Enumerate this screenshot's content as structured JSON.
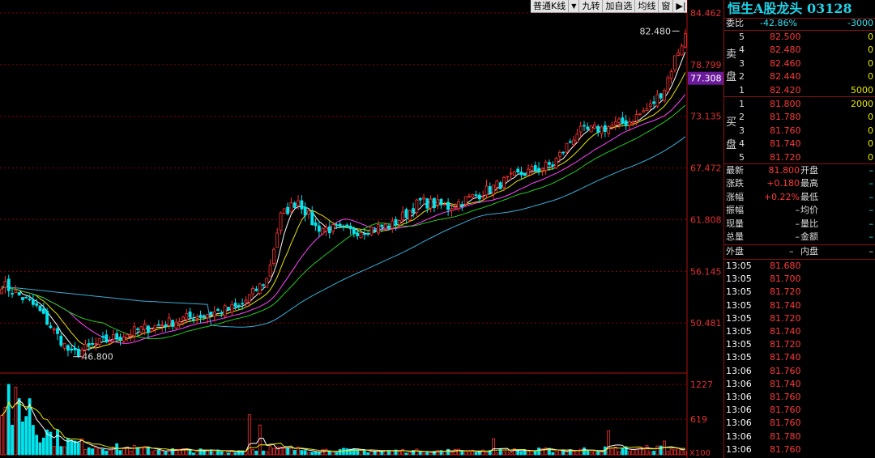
{
  "toolbar": {
    "items": [
      "普通K线",
      "九转",
      "加自选",
      "均线",
      "窗"
    ],
    "dropdown_icon": "dropdown-arrow-icon",
    "end_icon": "arrow-right-icon"
  },
  "quote": {
    "title": "恒生A股龙头 03128",
    "weibi": {
      "label": "委比",
      "value": "-42.86%",
      "diff": "-3000"
    },
    "sell_label": [
      "卖",
      "盘"
    ],
    "buy_label": [
      "买",
      "盘"
    ],
    "asks": [
      {
        "level": "5",
        "price": "82.500",
        "volume": "0"
      },
      {
        "level": "4",
        "price": "82.480",
        "volume": "0"
      },
      {
        "level": "3",
        "price": "82.460",
        "volume": "0"
      },
      {
        "level": "2",
        "price": "82.440",
        "volume": "0"
      },
      {
        "level": "1",
        "price": "82.420",
        "volume": "5000"
      }
    ],
    "bids": [
      {
        "level": "1",
        "price": "81.800",
        "volume": "2000"
      },
      {
        "level": "2",
        "price": "81.780",
        "volume": "0"
      },
      {
        "level": "3",
        "price": "81.760",
        "volume": "0"
      },
      {
        "level": "4",
        "price": "81.740",
        "volume": "0"
      },
      {
        "level": "5",
        "price": "81.720",
        "volume": "0"
      }
    ],
    "stats": [
      {
        "l1": "最新",
        "v1": "81.800",
        "l2": "开盘",
        "v2": ""
      },
      {
        "l1": "涨跌",
        "v1": "+0.180",
        "l2": "最高",
        "v2": ""
      },
      {
        "l1": "涨幅",
        "v1": "+0.22%",
        "l2": "最低",
        "v2": ""
      },
      {
        "l1": "振幅",
        "v1": "",
        "l2": "均价",
        "v2": ""
      },
      {
        "l1": "现量",
        "v1": "",
        "l2": "量比",
        "v2": ""
      },
      {
        "l1": "总量",
        "v1": "",
        "l2": "金额",
        "v2": ""
      }
    ],
    "dash": "–",
    "outer_label": "外盘",
    "inner_label": "内盘",
    "ticks": [
      {
        "time": "13:05",
        "price": "81.680"
      },
      {
        "time": "13:05",
        "price": "81.700"
      },
      {
        "time": "13:05",
        "price": "81.720"
      },
      {
        "time": "13:05",
        "price": "81.740"
      },
      {
        "time": "13:05",
        "price": "81.720"
      },
      {
        "time": "13:05",
        "price": "81.740"
      },
      {
        "time": "13:05",
        "price": "81.720"
      },
      {
        "time": "13:05",
        "price": "81.740"
      },
      {
        "time": "13:06",
        "price": "81.760"
      },
      {
        "time": "13:06",
        "price": "81.740"
      },
      {
        "time": "13:06",
        "price": "81.760"
      },
      {
        "time": "13:06",
        "price": "81.760"
      },
      {
        "time": "13:06",
        "price": "81.760"
      },
      {
        "time": "13:06",
        "price": "81.780"
      },
      {
        "time": "13:06",
        "price": "81.760"
      }
    ]
  },
  "chart_data": {
    "type": "candlestick",
    "price_axis_ticks": [
      "84.462",
      "78.799",
      "73.135",
      "67.472",
      "61.808",
      "56.145",
      "50.481"
    ],
    "current_price_label": "77.308",
    "high_label": "82.480",
    "low_label": "46.800",
    "volume_axis_ticks": [
      "1227",
      "619"
    ],
    "volume_unit": "X100",
    "colors": {
      "up": "#ff3232",
      "down": "#00e5ee",
      "ma1": "#ffffff",
      "ma2": "#e6e600",
      "ma3": "#ff44ff",
      "ma4": "#22cc22",
      "ma5": "#3aaed8",
      "grid": "#8b0000"
    },
    "price_keypoints": [
      [
        0,
        54.8
      ],
      [
        10,
        52.2
      ],
      [
        20,
        47.0
      ],
      [
        28,
        48.3
      ],
      [
        40,
        49.8
      ],
      [
        55,
        51.2
      ],
      [
        68,
        52.2
      ],
      [
        76,
        55.3
      ],
      [
        80,
        62.2
      ],
      [
        85,
        64.0
      ],
      [
        90,
        61.0
      ],
      [
        100,
        60.5
      ],
      [
        112,
        61.2
      ],
      [
        120,
        63.8
      ],
      [
        128,
        63.2
      ],
      [
        138,
        64.8
      ],
      [
        148,
        66.7
      ],
      [
        158,
        67.9
      ],
      [
        165,
        71.4
      ],
      [
        172,
        71.8
      ],
      [
        180,
        72.6
      ],
      [
        186,
        74.2
      ],
      [
        190,
        76.2
      ],
      [
        193,
        79.5
      ],
      [
        196,
        82.0
      ]
    ],
    "volume_keypoints": [
      [
        0,
        560
      ],
      [
        3,
        1050
      ],
      [
        5,
        1000
      ],
      [
        7,
        900
      ],
      [
        10,
        650
      ],
      [
        14,
        420
      ],
      [
        20,
        260
      ],
      [
        30,
        170
      ],
      [
        45,
        110
      ],
      [
        60,
        80
      ],
      [
        70,
        90
      ],
      [
        75,
        150
      ],
      [
        80,
        120
      ],
      [
        100,
        90
      ],
      [
        120,
        80
      ],
      [
        140,
        90
      ],
      [
        160,
        100
      ],
      [
        175,
        120
      ],
      [
        190,
        140
      ],
      [
        196,
        90
      ]
    ],
    "volume_spikes": [
      [
        2,
        1230
      ],
      [
        4,
        1180
      ],
      [
        8,
        980
      ],
      [
        71,
        700
      ],
      [
        74,
        520
      ],
      [
        141,
        280
      ],
      [
        174,
        420
      ],
      [
        190,
        240
      ]
    ]
  }
}
